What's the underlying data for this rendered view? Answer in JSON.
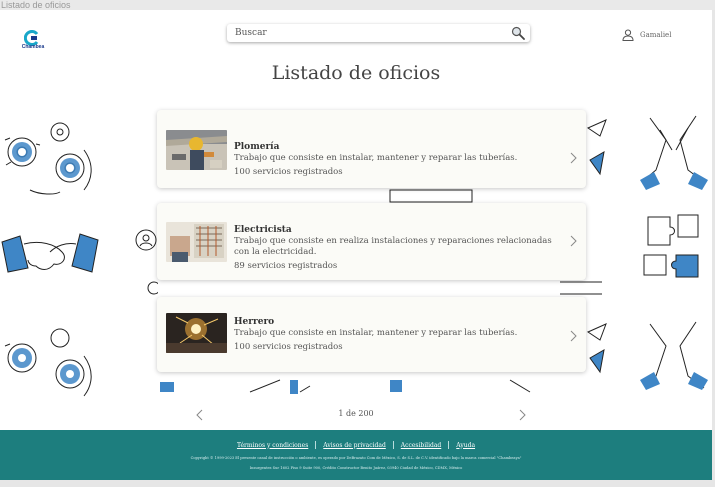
{
  "window": {
    "title": "Listado de oficios"
  },
  "header": {
    "logo_text": "Chambea",
    "search": {
      "placeholder": "Buscar",
      "value": ""
    },
    "user_name": "Gamaliel"
  },
  "main": {
    "title": "Listado de oficios",
    "cards": [
      {
        "name": "Plomería",
        "description": "Trabajo que consiste en instalar, mantener y reparar las tuberías.",
        "count": "100 servicios registrados",
        "image": "plumber-photo"
      },
      {
        "name": "Electricista",
        "description": "Trabajo que consiste en realiza instalaciones y reparaciones relacionadas con la electricidad.",
        "count": "89 servicios registrados",
        "image": "electrician-photo"
      },
      {
        "name": "Herrero",
        "description": "Trabajo que consiste en instalar, mantener y reparar las tuberías.",
        "count": "100 servicios registrados",
        "image": "welder-photo"
      }
    ],
    "pagination": {
      "text": "1 de 200"
    }
  },
  "footer": {
    "links": [
      "Términos y condiciones",
      "Avisos de privacidad",
      "Accesibilidad",
      "Ayuda"
    ],
    "copyright": "Copyright © 1999-2023 El presente canal de instrucción o ambiente, es operado por DeBrazato Com de México, S. de S.L. de C.V. identificado bajo la marca comercial \"Chambeaya\"",
    "address": "Insurgentes Sur 1602 Piso 9 Suite 900, Crédito Constructor Benito Juárez, 03940 Ciudad de México, CDMX, México"
  },
  "colors": {
    "footer_bg": "#1d7e7e",
    "logo_blue": "#1a3a8c",
    "logo_cyan": "#19a7c9",
    "doodle_blue": "#3f86c6"
  }
}
